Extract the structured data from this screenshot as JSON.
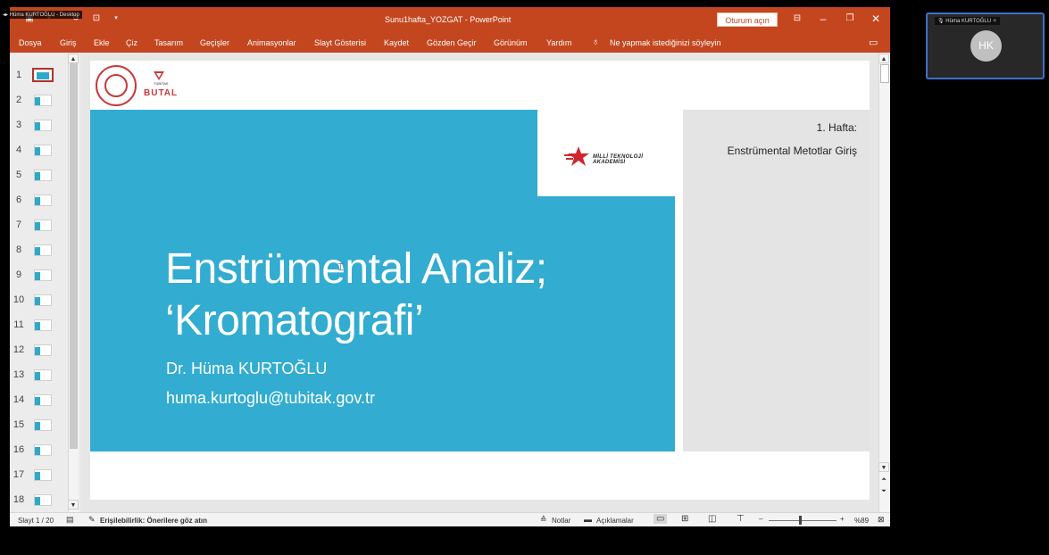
{
  "window": {
    "title": "Sunu1hafta_YOZGAT  -  PowerPoint",
    "signin_label": "Oturum açın",
    "share_label": "Hüma KURTOĞLU - Desktop"
  },
  "menu": {
    "items": [
      "Dosya",
      "Giriş",
      "Ekle",
      "Çiz",
      "Tasarım",
      "Geçişler",
      "Animasyonlar",
      "Slayt Gösterisi",
      "Kaydet",
      "Gözden Geçir",
      "Görünüm",
      "Yardım"
    ],
    "tell_me": "Ne yapmak istediğinizi söyleyin"
  },
  "thumbnails": {
    "numbers": [
      "1",
      "2",
      "3",
      "4",
      "5",
      "6",
      "7",
      "8",
      "9",
      "10",
      "11",
      "12",
      "13",
      "14",
      "15",
      "16",
      "17",
      "18"
    ],
    "selected_index": 0
  },
  "slide": {
    "title_line1": "Enstrümental Analiz;",
    "title_line2": "‘Kromatografi’",
    "author": "Dr. Hüma KURTOĞLU",
    "email": "huma.kurtoglu@tubitak.gov.tr",
    "week": "1. Hafta:",
    "subtitle": "Enstrümental Metotlar Giriş",
    "logo_left_text": "BUTAL",
    "logo_tubitak_text": "TÜBİTAK",
    "logo_mta_text": "MİLLİ TEKNOLOJİ AKADEMİSİ"
  },
  "statusbar": {
    "slide_counter": "Slayt 1 / 20",
    "accessibility": "Erişilebilirlik: Önerilere göz atın",
    "notes_label": "Notlar",
    "comments_label": "Açıklamalar",
    "zoom_label": "%89"
  },
  "participant": {
    "name": "Hüma KURTOĞLU",
    "initials": "HK"
  },
  "colors": {
    "ribbon": "#c4461f",
    "slide_blue": "#32acd0",
    "accent_red": "#c8383a"
  }
}
